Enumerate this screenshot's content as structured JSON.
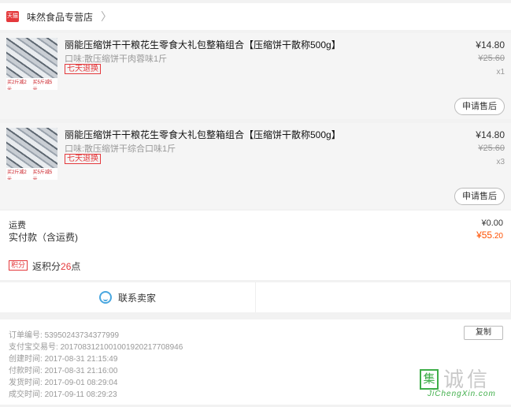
{
  "store": {
    "logo_text": "天猫",
    "name": "味然食品专营店",
    "chevron": "〉"
  },
  "items": [
    {
      "title": "丽能压缩饼干干粮花生零食大礼包整箱组合【压缩饼干散称500g】",
      "spec": "口味:散压缩饼干肉蓉味1斤",
      "badge": "七天退换",
      "price": "¥14.80",
      "original_price": "¥25.60",
      "qty": "x1",
      "after_sale": "申请售后",
      "thumb_tags": [
        "买2斤减2元",
        "买5斤减5元"
      ]
    },
    {
      "title": "丽能压缩饼干干粮花生零食大礼包整箱组合【压缩饼干散称500g】",
      "spec": "口味:散压缩饼干综合口味1斤",
      "badge": "七天退换",
      "price": "¥14.80",
      "original_price": "¥25.60",
      "qty": "x3",
      "after_sale": "申请售后",
      "thumb_tags": [
        "买2斤减2元",
        "买5斤减5元"
      ]
    }
  ],
  "summary": {
    "shipping_label": "运费",
    "shipping_value": "¥0.00",
    "paid_label": "实付款（含运费)",
    "paid_int": "¥55",
    "paid_dec": ".20",
    "points_badge": "积分",
    "points_prefix": "返积分",
    "points_value": "26",
    "points_suffix": "点"
  },
  "contact": {
    "label": "联系卖家"
  },
  "order_info": {
    "copy_label": "复制",
    "rows": [
      {
        "label": "订单编号:",
        "value": "53950243734377999"
      },
      {
        "label": "支付宝交易号:",
        "value": "2017083121001001920217708946"
      },
      {
        "label": "创建时间:",
        "value": "2017-08-31 21:15:49"
      },
      {
        "label": "付款时间:",
        "value": "2017-08-31 21:16:00"
      },
      {
        "label": "发货时间:",
        "value": "2017-09-01 08:29:04"
      },
      {
        "label": "成交时间:",
        "value": "2017-09-11 08:29:23"
      }
    ]
  },
  "watermark": {
    "box_char": "集",
    "text": "诚信",
    "url": "JiChengXin.com"
  },
  "colors": {
    "accent": "#ff5000",
    "brand_red": "#e4393c",
    "contact_icon": "#49a7e0",
    "watermark_green": "#3fae49"
  }
}
